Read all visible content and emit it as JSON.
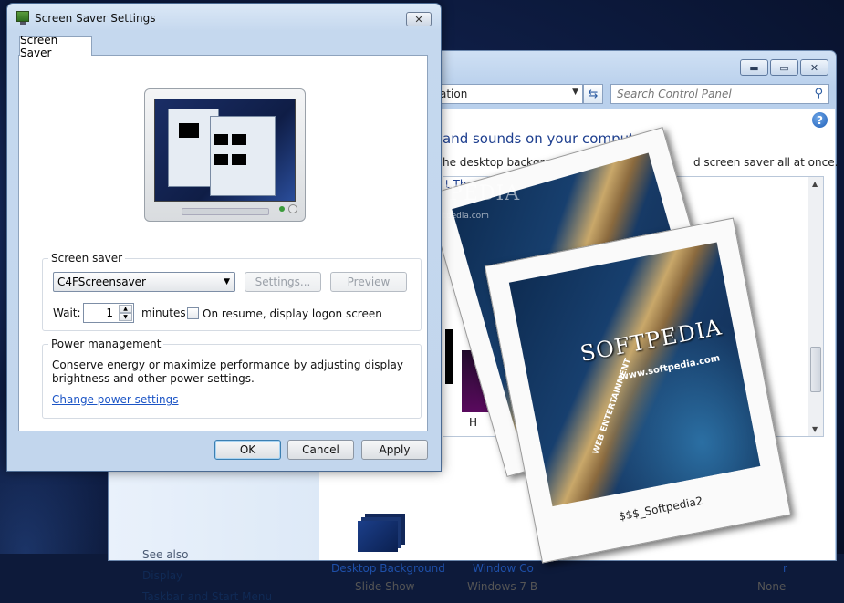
{
  "control_panel": {
    "address_text": "ation",
    "search_placeholder": "Search Control Panel",
    "heading": "and sounds on your computer",
    "description_left": "he desktop background, wind",
    "description_right": "d screen saver all at once.",
    "tab_fragment": "t The",
    "tile_caption": "H",
    "see_also": "See also",
    "side_links": [
      "Display",
      "Taskbar and Start Menu"
    ],
    "bottom_items": [
      {
        "label": "Desktop Background",
        "sub": "Slide Show"
      },
      {
        "label": "Window Co",
        "sub": "Windows 7 B"
      },
      {
        "label": "r",
        "sub": "None"
      }
    ]
  },
  "overlay": {
    "watermark": "SOFTPEDIA",
    "watermark_sub": "www.softpedia.com",
    "photo_logo": "SOFTPEDIA",
    "photo_url": "www.softpedia.com",
    "photo_arc": "WEB ENTERTAINMENT",
    "caption": "$$$_Softpedia2"
  },
  "dialog": {
    "title": "Screen Saver Settings",
    "tab": "Screen Saver",
    "screen_saver": {
      "group_label": "Screen saver",
      "selected": "C4FScreensaver",
      "settings_label": "Settings...",
      "preview_label": "Preview",
      "wait_label": "Wait:",
      "wait_value": "1",
      "minutes_label": "minutes",
      "resume_label": "On resume, display logon screen"
    },
    "power": {
      "group_label": "Power management",
      "description_line1": "Conserve energy or maximize performance by adjusting display",
      "description_line2": "brightness and other power settings.",
      "link": "Change power settings"
    },
    "buttons": {
      "ok": "OK",
      "cancel": "Cancel",
      "apply": "Apply"
    }
  }
}
